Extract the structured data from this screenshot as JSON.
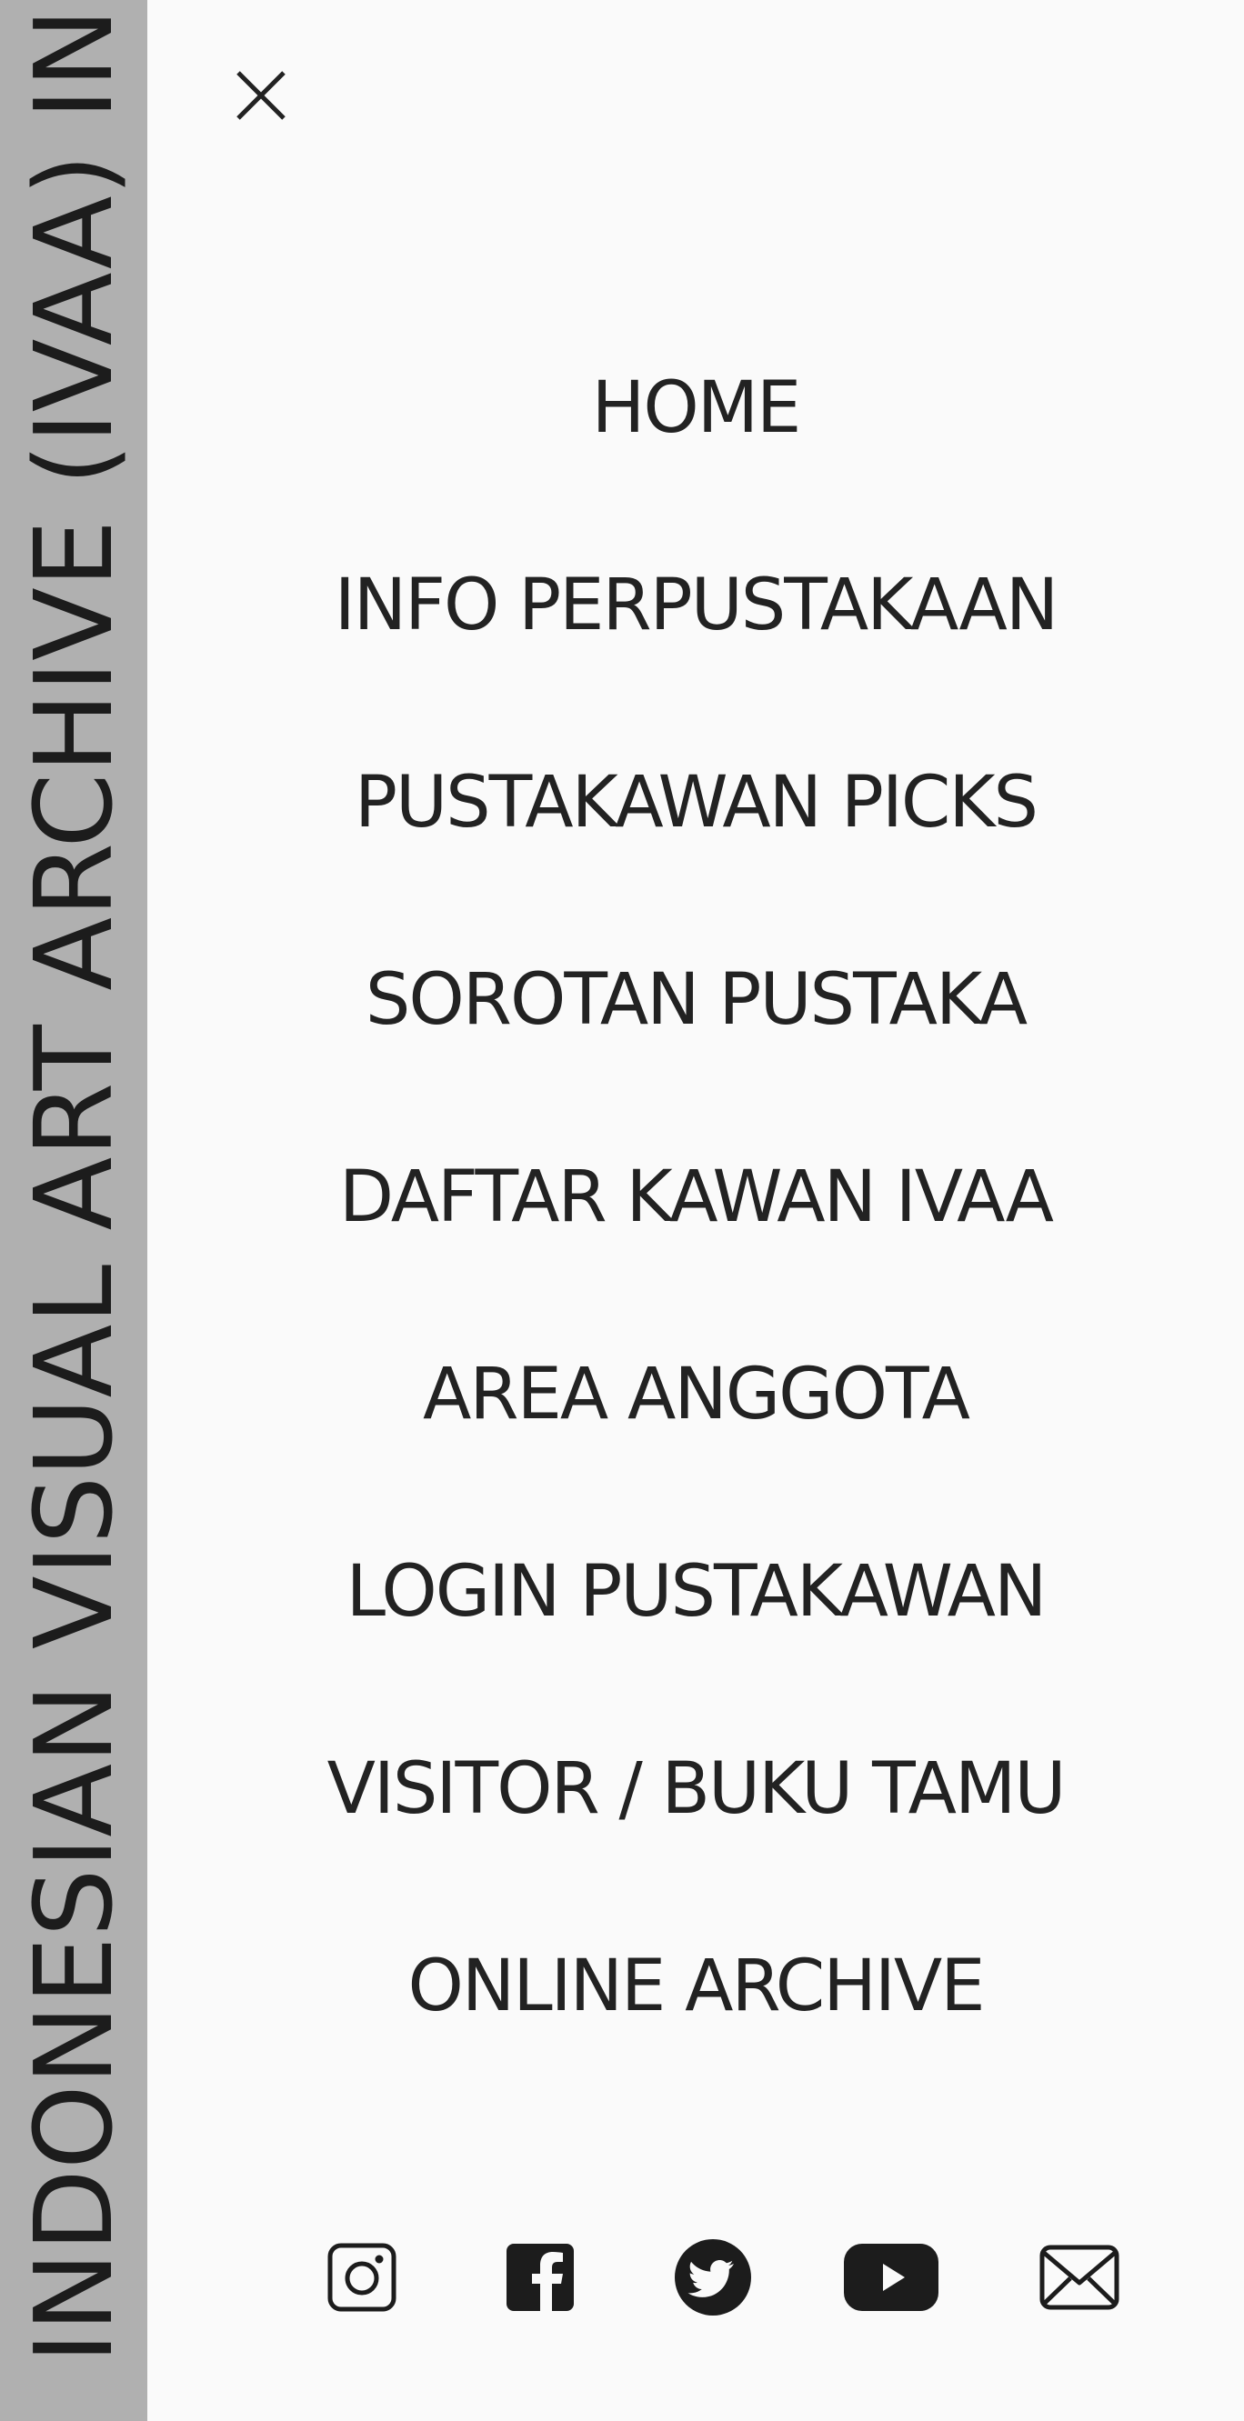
{
  "side_band": {
    "title": "INDONESIAN VISUAL ART ARCHIVE (IVAA) IN",
    "color": "#b0b0b0"
  },
  "close": {
    "icon": "close-icon"
  },
  "menu": {
    "items": [
      {
        "label": "HOME"
      },
      {
        "label": "INFO PERPUSTAKAAN"
      },
      {
        "label": "PUSTAKAWAN PICKS"
      },
      {
        "label": "SOROTAN PUSTAKA"
      },
      {
        "label": "DAFTAR KAWAN IVAA"
      },
      {
        "label": "AREA ANGGOTA"
      },
      {
        "label": "LOGIN PUSTAKAWAN"
      },
      {
        "label": "VISITOR / BUKU TAMU"
      },
      {
        "label": "ONLINE ARCHIVE"
      }
    ]
  },
  "social": {
    "icons": [
      "instagram-icon",
      "facebook-icon",
      "twitter-icon",
      "youtube-icon",
      "email-icon"
    ]
  }
}
